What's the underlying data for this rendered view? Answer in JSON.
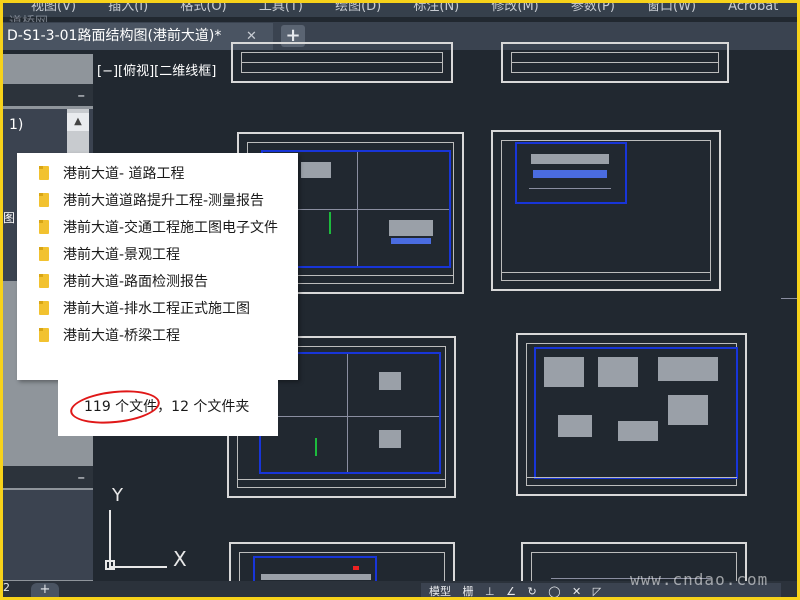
{
  "menubar": {
    "items": [
      "视图(V)",
      "插入(I)",
      "格式(O)",
      "工具(T)",
      "绘图(D)",
      "标注(N)",
      "修改(M)",
      "参数(P)",
      "窗口(W)",
      "Acrobat"
    ]
  },
  "watermark_top": "道桥网",
  "tab": {
    "title": "D-S1-3-01路面结构图(港前大道)*",
    "close": "✕",
    "add": "+"
  },
  "palette": {
    "collapse": "–",
    "item": "1)",
    "letter": "图",
    "collapse2": "–"
  },
  "viewport": {
    "label": "[−][俯视][二维线框]"
  },
  "ucs": {
    "y": "Y",
    "x": "X"
  },
  "popup": {
    "folders": [
      "港前大道- 道路工程",
      "港前大道道路提升工程-测量报告",
      "港前大道-交通工程施工图电子文件",
      "港前大道-景观工程",
      "港前大道-路面检测报告",
      "港前大道-排水工程正式施工图",
      "港前大道-桥梁工程"
    ],
    "count": "119 个文件，12 个文件夹"
  },
  "bottom": {
    "num": "2",
    "add": "+",
    "status": [
      "模型",
      "栅",
      "⊥",
      "∠",
      "↻",
      "◯",
      "✕",
      "◸"
    ]
  },
  "watermark": "www.cndao.com",
  "colors": {
    "frame_border": "#f7d21a",
    "background": "#212830",
    "highlight_circle": "#e01818",
    "folder": "#f2c230"
  }
}
